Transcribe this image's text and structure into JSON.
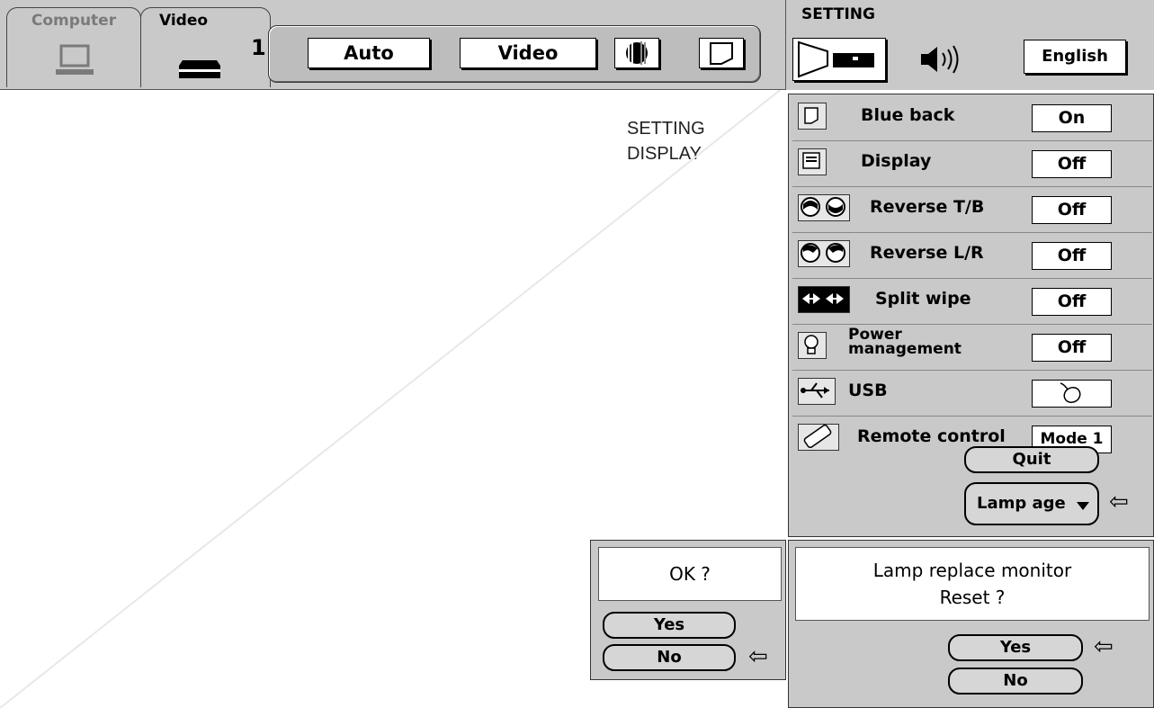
{
  "tabs": [
    {
      "label": "Computer",
      "icon": "laptop-icon"
    },
    {
      "label": "Video",
      "icon": "vcr-icon",
      "number": "1"
    }
  ],
  "video_panel": {
    "auto_label": "Auto",
    "source_label": "Video",
    "icons": [
      "picture-adjust-icon",
      "screen-icon"
    ]
  },
  "setting_header": {
    "title": "SETTING",
    "icons": [
      "screen-projector-icon",
      "speaker-icon"
    ],
    "language": "English"
  },
  "annotation": {
    "line1": "SETTING",
    "line2": "DISPLAY"
  },
  "settings": [
    {
      "label": "Blue back",
      "value": "On",
      "icon": "blue-back-icon"
    },
    {
      "label": "Display",
      "value": "Off",
      "icon": "display-icon"
    },
    {
      "label": "Reverse T/B",
      "value": "Off",
      "icon": "reverse-tb-icon"
    },
    {
      "label": "Reverse L/R",
      "value": "Off",
      "icon": "reverse-lr-icon"
    },
    {
      "label": "Split wipe",
      "value": "Off",
      "icon": "split-wipe-icon"
    },
    {
      "label_line1": "Power",
      "label_line2": "management",
      "value": "Off",
      "icon": "lightbulb-icon"
    },
    {
      "label": "USB",
      "value": "",
      "icon": "usb-icon",
      "value_icon": "mouse-icon"
    },
    {
      "label": "Remote control",
      "value": "Mode 1",
      "icon": "remote-control-icon"
    }
  ],
  "menu_buttons": {
    "quit": "Quit",
    "lamp_age": "Lamp age"
  },
  "ok_dialog": {
    "message": "OK ?",
    "yes": "Yes",
    "no": "No"
  },
  "lamp_dialog": {
    "line1": "Lamp replace monitor",
    "line2": "Reset ?",
    "yes": "Yes",
    "no": "No"
  }
}
